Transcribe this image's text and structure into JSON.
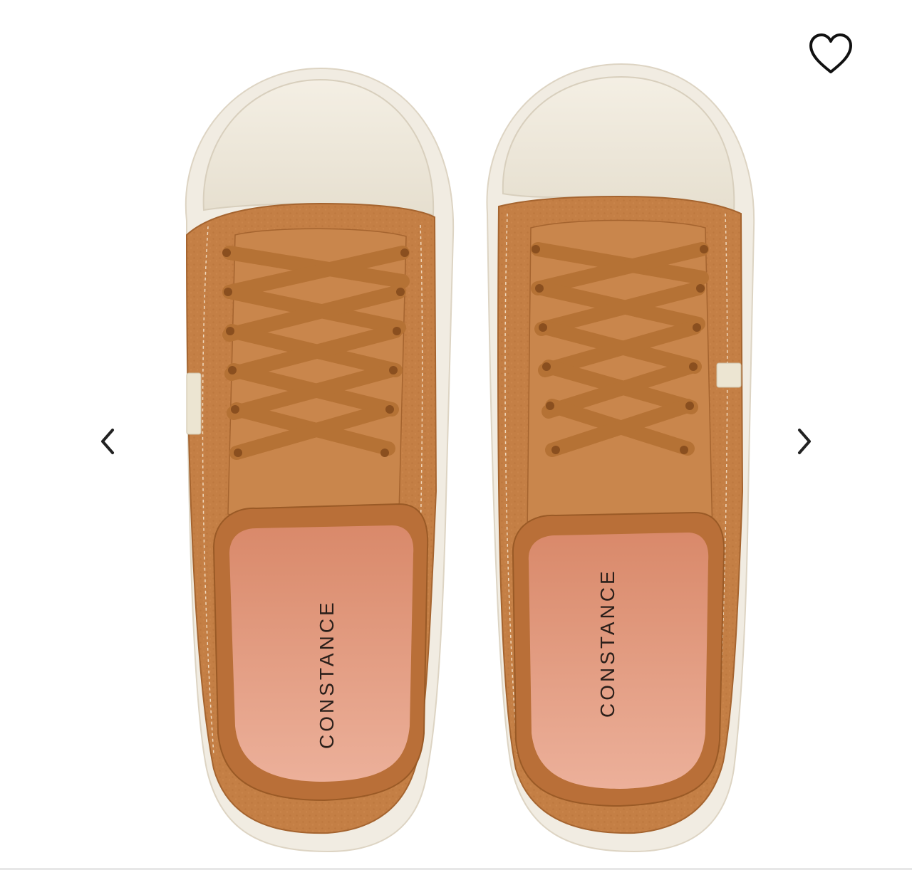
{
  "gallery": {
    "product_image": {
      "alt": "Tan leather sneakers with cream toe caps, top view",
      "insole_brand": "CONSTANCE",
      "colors": {
        "leather": "#c47f45",
        "leather_dark": "#a5642f",
        "lace": "#b57235",
        "toe_cap": "#eee8da",
        "sole": "#f1ece2",
        "insole": "#e8a58c"
      }
    },
    "favorite": {
      "icon": "heart-outline-icon"
    },
    "prev": {
      "icon": "chevron-left-icon"
    },
    "next": {
      "icon": "chevron-right-icon"
    }
  }
}
